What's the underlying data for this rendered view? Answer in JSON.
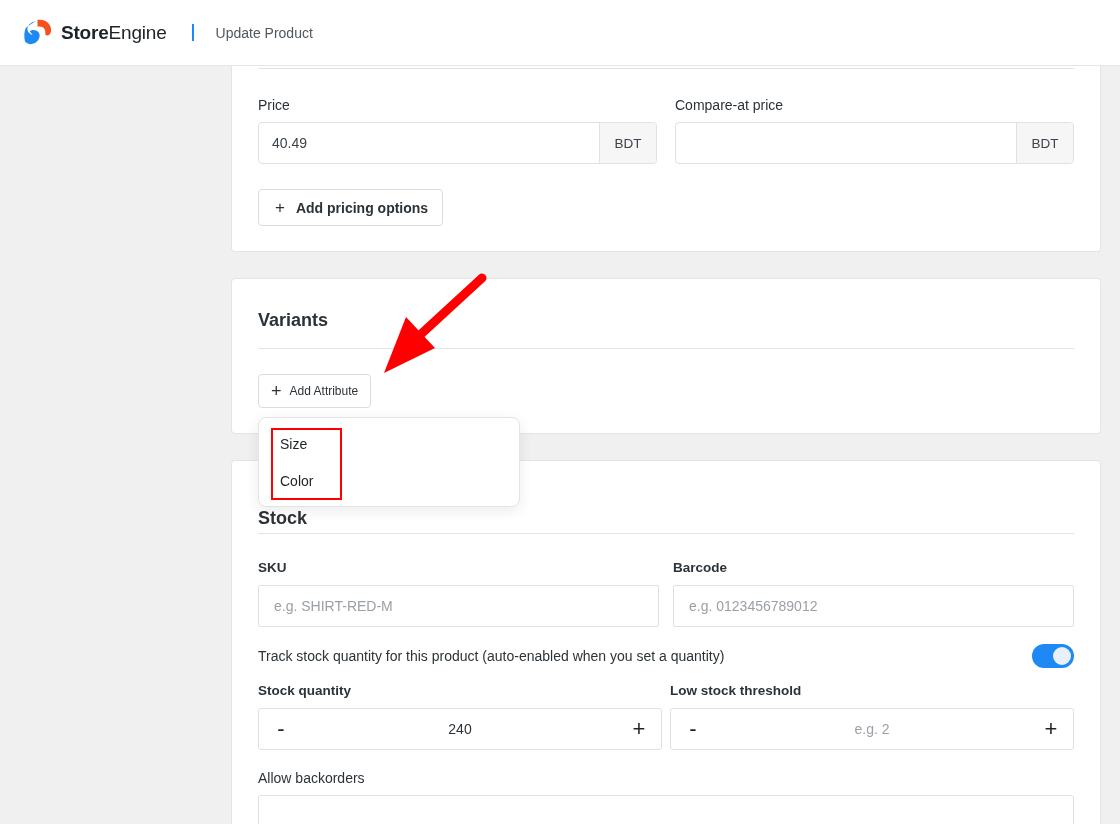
{
  "header": {
    "brand_bold": "Store",
    "brand_light": "Engine",
    "page_title": "Update Product"
  },
  "pricing": {
    "fields": [
      {
        "label": "Price",
        "value": "40.49",
        "suffix": "BDT"
      },
      {
        "label": "Compare-at price",
        "suffix": "BDT"
      }
    ],
    "add_button": {
      "icon": "+",
      "label": "Add pricing options"
    }
  },
  "variants": {
    "title": "Variants",
    "add_button": {
      "icon": "+",
      "label": "Add Attribute"
    },
    "menu": {
      "open": true,
      "items": [
        "Size",
        "Color"
      ]
    }
  },
  "stock": {
    "title": "Stock",
    "fields": [
      {
        "label": "SKU",
        "placeholder": "e.g. SHIRT-RED-M"
      },
      {
        "label": "Barcode",
        "placeholder": "e.g. 0123456789012"
      }
    ],
    "track": {
      "label": "Track stock quantity for this product (auto-enabled when you set a quantity)",
      "on": true
    },
    "steppers": [
      {
        "label": "Stock quantity",
        "value": "240",
        "minus": "-",
        "plus": "+"
      },
      {
        "label": "Low stock threshold",
        "placeholder": "e.g. 2",
        "minus": "-",
        "plus": "+"
      }
    ],
    "backorders": {
      "label": "Allow backorders"
    }
  },
  "annotation": {
    "arrow": true,
    "highlight": true
  }
}
